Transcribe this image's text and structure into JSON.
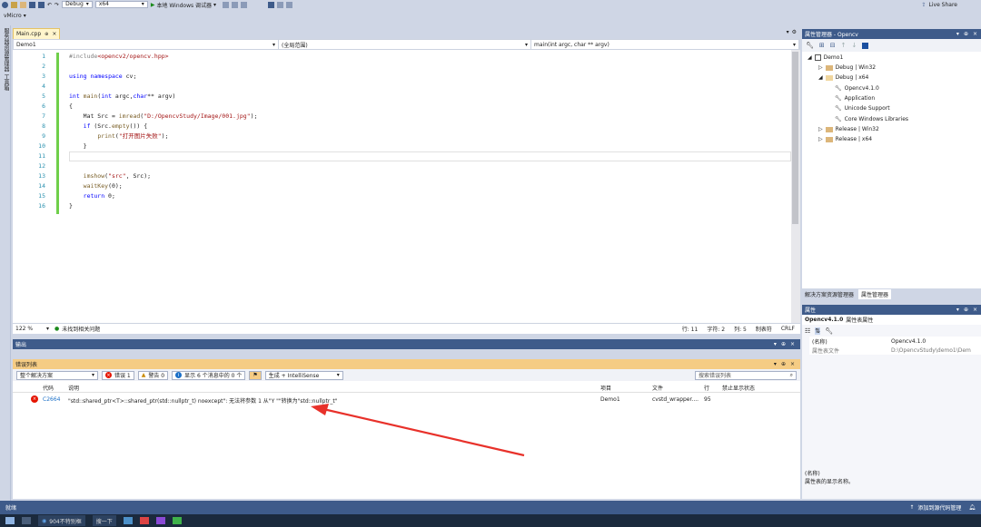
{
  "toolbar": {
    "config": "Debug",
    "platform": "x64",
    "debugger": "本地 Windows 调试器",
    "live_share": "Live Share",
    "project_selector": "vMicro"
  },
  "left_strip": {
    "tab1": "服务器资源管理器",
    "tab2": "工具箱"
  },
  "editor": {
    "tab_label": "Main.cpp",
    "nav_project": "Demo1",
    "nav_scope": "(全局范围)",
    "nav_function": "main(int argc, char ** argv)",
    "lines": [
      {
        "n": "1",
        "text": "#include<opencv2/opencv.hpp>"
      },
      {
        "n": "2",
        "text": ""
      },
      {
        "n": "3",
        "text": "using namespace cv;"
      },
      {
        "n": "4",
        "text": ""
      },
      {
        "n": "5",
        "text": "int main(int argc,char** argv)"
      },
      {
        "n": "6",
        "text": "{"
      },
      {
        "n": "7",
        "text": "    Mat Src = imread(\"D:/OpencvStudy/Image/001.jpg\");"
      },
      {
        "n": "8",
        "text": "    if (Src.empty()) {"
      },
      {
        "n": "9",
        "text": "        print(\"打开图片失败\");"
      },
      {
        "n": "10",
        "text": "    }"
      },
      {
        "n": "11",
        "text": ""
      },
      {
        "n": "12",
        "text": ""
      },
      {
        "n": "13",
        "text": "    imshow(\"src\", Src);"
      },
      {
        "n": "14",
        "text": "    waitKey(0);"
      },
      {
        "n": "15",
        "text": "    return 0;"
      },
      {
        "n": "16",
        "text": "}"
      }
    ],
    "zoom": "122 %",
    "status_msg": "未找到相关问题",
    "pos_line": "行: 11",
    "pos_char": "字符: 2",
    "pos_col": "列: 5",
    "tab_mode": "制表符",
    "eol": "CRLF"
  },
  "output": {
    "title": "输出"
  },
  "error_list": {
    "title": "错误列表",
    "scope": "整个解决方案",
    "errors_btn": "错误 1",
    "warnings_btn": "警告 0",
    "messages_btn": "显示 6 个消息中的 0 个",
    "build_filter": "生成 + IntelliSense",
    "search_placeholder": "搜索错误列表",
    "columns": {
      "code": "代码",
      "desc": "说明",
      "project": "项目",
      "file": "文件",
      "line": "行",
      "suppress": "禁止显示状态"
    },
    "rows": [
      {
        "code": "C2664",
        "desc": "\"std::shared_ptr<T>::shared_ptr(std::nullptr_t) noexcept\": 无法将参数 1 从\"Y \"\"转换为\"std::nullptr_t\"",
        "project": "Demo1",
        "file": "cvstd_wrapper....",
        "line": "95",
        "suppress": ""
      }
    ]
  },
  "property_manager": {
    "title": "属性管理器 - Opencv",
    "tree": [
      {
        "label": "Demo1"
      },
      {
        "label": "Debug | Win32"
      },
      {
        "label": "Debug | x64"
      },
      {
        "label": "Opencv4.1.0"
      },
      {
        "label": "Application"
      },
      {
        "label": "Unicode Support"
      },
      {
        "label": "Core Windows Libraries"
      },
      {
        "label": "Release | Win32"
      },
      {
        "label": "Release | x64"
      }
    ],
    "tab_solution": "解决方案资源管理器",
    "tab_props": "属性管理器"
  },
  "properties": {
    "title": "属性",
    "object": "Opencv4.1.0",
    "object_type": "属性表属性",
    "rows": [
      {
        "name": "(名称)",
        "value": "Opencv4.1.0"
      },
      {
        "name": "属性表文件",
        "value": "D:\\OpencvStudy\\demo1\\Dem"
      }
    ],
    "desc_title": "(名称)",
    "desc_text": "属性表的显示名称。"
  },
  "statusbar": {
    "ready": "就绪",
    "source_control": "添加到源代码管理"
  },
  "taskbar": {
    "app1": "904不特别框",
    "app2": "搜一下"
  },
  "colors": {
    "accent": "#3e5b8a",
    "error_header": "#f5cc84",
    "arrow": "#e8312a"
  }
}
